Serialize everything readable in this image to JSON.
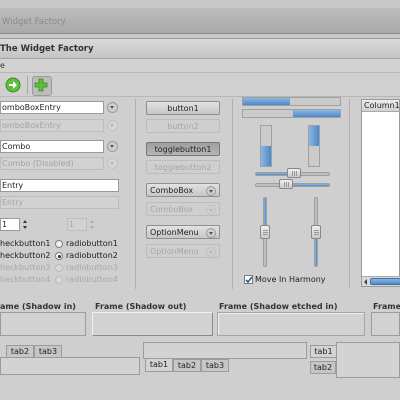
{
  "back_window": {
    "title": "Widget Factory"
  },
  "window": {
    "title": "The Widget Factory",
    "menu_label": "e"
  },
  "toolbar": {
    "icons": [
      "go-forward-icon",
      "add-icon"
    ]
  },
  "entries": {
    "combo_box_entry": "omboBoxEntry",
    "combo_box_entry_disabled": "omboBoxEntry",
    "combo": "Combo",
    "combo_disabled": "Combo (Disabled)",
    "entry": "Entry",
    "entry_disabled": "Entry",
    "spin_value": "1",
    "spin_value_disabled": "1"
  },
  "checks": [
    "heckbutton1",
    "heckbutton2",
    "heckbutton3",
    "heckbutton4"
  ],
  "radios": [
    "radiobutton1",
    "radiobutton2",
    "radiobutton3",
    "radiobutton4"
  ],
  "buttons": {
    "button1": "button1",
    "button2": "button2",
    "toggle1": "togglebutton1",
    "toggle2": "togglebutton2",
    "combobox": "ComboBox",
    "combobox_disabled": "ComboBox",
    "optionmenu": "OptionMenu",
    "optionmenu_disabled": "OptionMenu"
  },
  "scales": {
    "move_in_harmony": "Move In Harmony",
    "move_in_harmony_checked": true
  },
  "treeview": {
    "column_header": "Column1"
  },
  "frames": {
    "shadow_in": "ame (Shadow in)",
    "shadow_out": "Frame (Shadow out)",
    "shadow_etched_in": "Frame (Shadow etched in)",
    "fourth": "Frame"
  },
  "tabs": {
    "left": [
      "tab2",
      "tab3"
    ],
    "middle": [
      "tab1",
      "tab2",
      "tab3"
    ],
    "right": [
      "tab1",
      "tab2"
    ]
  },
  "colors": {
    "accent": "#4f88c8",
    "window_bg": "#cfcfcf",
    "desktop": "#2f5a8c",
    "toolbar_icon": "#5fbf3a"
  }
}
